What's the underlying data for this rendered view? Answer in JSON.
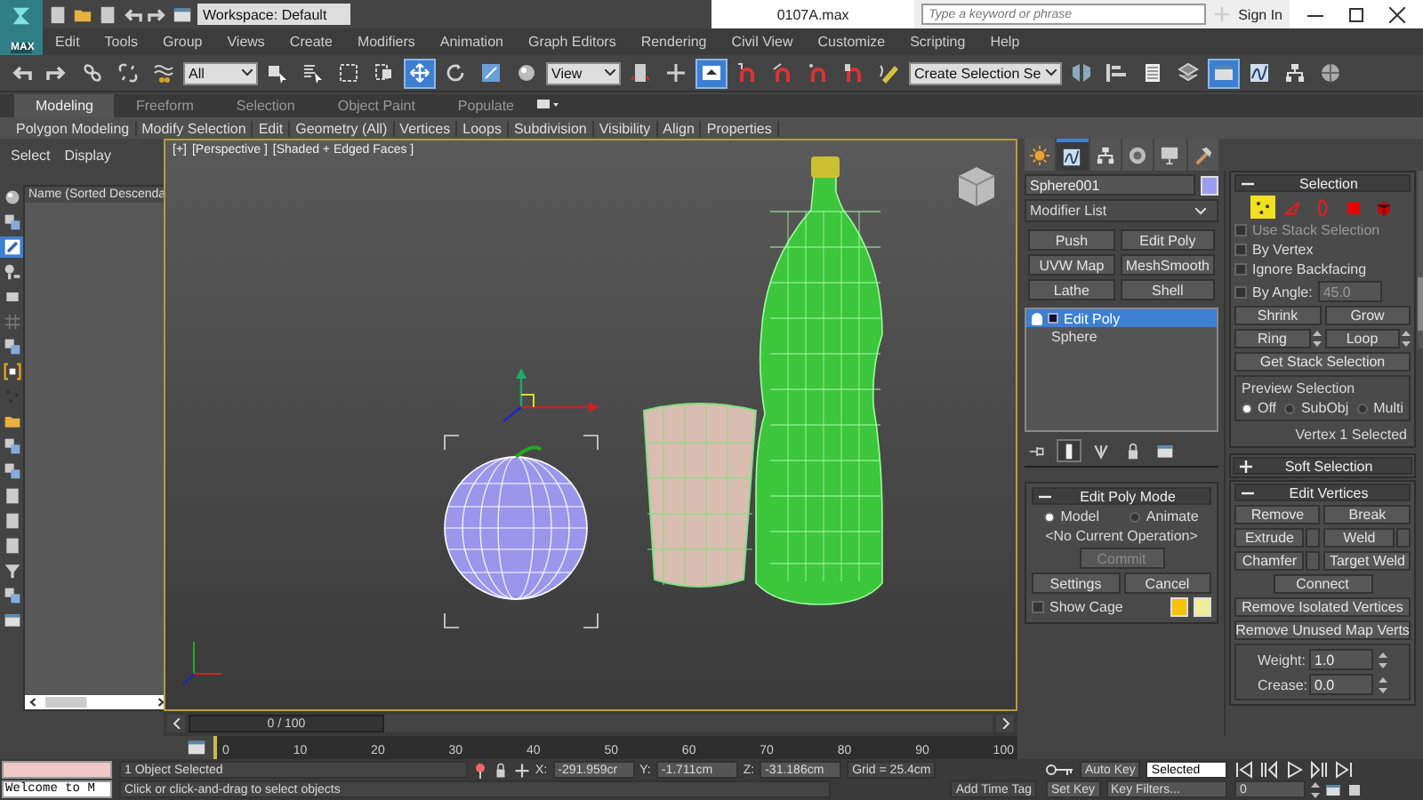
{
  "logo": {
    "label": "MAX"
  },
  "title_bar": {
    "workspace": "Workspace: Default",
    "title": "0107A.max",
    "search": {
      "placeholder": "Type a keyword or phrase"
    },
    "sign_in": "Sign In"
  },
  "menu": [
    "Edit",
    "Tools",
    "Group",
    "Views",
    "Create",
    "Modifiers",
    "Animation",
    "Graph Editors",
    "Rendering",
    "Civil View",
    "Customize",
    "Scripting",
    "Help"
  ],
  "toolbar": [
    {
      "kind": "undo",
      "selected": false
    },
    {
      "kind": "redo",
      "selected": false
    },
    {
      "kind": "chain",
      "selected": false
    },
    {
      "kind": "broken-chain",
      "selected": false
    },
    {
      "kind": "wave",
      "selected": false
    },
    {
      "kind": "dropdown",
      "value": "All",
      "selected": false
    },
    {
      "kind": "cube-cursor",
      "selected": false
    },
    {
      "kind": "list-cursor",
      "selected": false
    },
    {
      "kind": "dashed-square",
      "selected": false
    },
    {
      "kind": "window-crossing",
      "selected": false
    },
    {
      "kind": "move",
      "selected": true
    },
    {
      "kind": "rotate",
      "selected": false
    },
    {
      "kind": "scale",
      "selected": false
    },
    {
      "kind": "sphere",
      "selected": false
    },
    {
      "kind": "dropdown",
      "value": "View",
      "selected": false
    },
    {
      "kind": "pivot",
      "selected": false
    },
    {
      "kind": "crosshair",
      "selected": false
    },
    {
      "kind": "box-arrow",
      "selected": true
    },
    {
      "kind": "magnet",
      "selected": false
    },
    {
      "kind": "angle-magnet",
      "selected": false
    },
    {
      "kind": "percent-magnet",
      "selected": false
    },
    {
      "kind": "spinner-magnet",
      "selected": false
    },
    {
      "kind": "pencil",
      "selected": false
    },
    {
      "kind": "dropdown",
      "value": "Create Selection Se",
      "selected": false
    },
    {
      "kind": "mirror",
      "selected": false
    },
    {
      "kind": "align",
      "selected": false
    },
    {
      "kind": "list",
      "selected": false
    },
    {
      "kind": "layers",
      "selected": false
    },
    {
      "kind": "window-panel",
      "selected": true
    },
    {
      "kind": "curve",
      "selected": false
    },
    {
      "kind": "schematic",
      "selected": false
    },
    {
      "kind": "sphere-grid",
      "selected": false
    }
  ],
  "ribbon": {
    "tabs": [
      {
        "label": "Modeling",
        "selected": true
      },
      {
        "label": "Freeform",
        "selected": false
      },
      {
        "label": "Selection",
        "selected": false
      },
      {
        "label": "Object Paint",
        "selected": false
      },
      {
        "label": "Populate",
        "selected": false
      }
    ],
    "panels": [
      "Polygon Modeling",
      "Modify Selection",
      "Edit",
      "Geometry (All)",
      "Vertices",
      "Loops",
      "Subdivision",
      "Visibility",
      "Align",
      "Properties"
    ]
  },
  "scene_explorer": {
    "tabs": [
      "Select",
      "Display"
    ],
    "column": "Name (Sorted Descenda",
    "tools": [
      {
        "kind": "sphere",
        "selected": false
      },
      {
        "kind": "boxes",
        "selected": false
      },
      {
        "kind": "brush",
        "selected": true
      },
      {
        "kind": "bone",
        "selected": false
      },
      {
        "kind": "camera",
        "selected": false
      },
      {
        "kind": "grid",
        "selected": false
      },
      {
        "kind": "boxes",
        "selected": false
      },
      {
        "kind": "bracket",
        "selected": false
      },
      {
        "kind": "dots",
        "selected": false
      },
      {
        "kind": "folder",
        "selected": false
      },
      {
        "kind": "boxes",
        "selected": false
      },
      {
        "kind": "boxes",
        "selected": false
      },
      {
        "kind": "page",
        "selected": false
      },
      {
        "kind": "page",
        "selected": false
      },
      {
        "kind": "page",
        "selected": false
      },
      {
        "kind": "funnel",
        "selected": false
      },
      {
        "kind": "boxes",
        "selected": false
      },
      {
        "kind": "window-panel",
        "selected": false
      }
    ]
  },
  "viewport": {
    "labels": [
      "[+]",
      "[Perspective ]",
      "[Shaded + Edged Faces ]"
    ]
  },
  "command_panel": {
    "tabs": [
      {
        "kind": "sun",
        "selected": false
      },
      {
        "kind": "curve",
        "selected": true
      },
      {
        "kind": "schematic",
        "selected": false
      },
      {
        "kind": "motion",
        "selected": false
      },
      {
        "kind": "monitor",
        "selected": false
      },
      {
        "kind": "hammer",
        "selected": false
      }
    ],
    "object_name": "Sphere001",
    "modifier_list": "Modifier List",
    "modifier_buttons": [
      "Push",
      "Edit Poly",
      "UVW Map",
      "MeshSmooth",
      "Lathe",
      "Shell"
    ],
    "stack": [
      {
        "label": "Edit Poly",
        "selected": true,
        "kind": "modifier"
      },
      {
        "label": "Sphere",
        "selected": false,
        "kind": "base"
      }
    ],
    "stack_tools": [
      {
        "kind": "pin",
        "selected": false
      },
      {
        "kind": "bar",
        "selected": true
      },
      {
        "kind": "fork",
        "selected": false
      },
      {
        "kind": "padlock",
        "selected": false
      },
      {
        "kind": "window-panel",
        "selected": false
      }
    ],
    "edit_poly_mode": {
      "title": "Edit Poly Mode",
      "expanded": true,
      "modes": [
        {
          "label": "Model",
          "selected": true
        },
        {
          "label": "Animate",
          "selected": false
        }
      ],
      "operation": "<No Current Operation>",
      "buttons": [
        {
          "label": "Commit",
          "disabled": true
        },
        {
          "label": "Settings",
          "disabled": false
        },
        {
          "label": "Cancel",
          "disabled": false
        }
      ],
      "show_cage": {
        "label": "Show Cage",
        "checked": false
      }
    },
    "selection": {
      "title": "Selection",
      "expanded": true,
      "levels": [
        {
          "kind": "dots",
          "selected": true
        },
        {
          "kind": "edge",
          "selected": false
        },
        {
          "kind": "border",
          "selected": false
        },
        {
          "kind": "square",
          "selected": false
        },
        {
          "kind": "cube",
          "selected": false
        }
      ],
      "options": [
        {
          "label": "Use Stack Selection",
          "checked": false,
          "disabled": true
        },
        {
          "label": "By Vertex",
          "checked": false,
          "disabled": false
        },
        {
          "label": "Ignore Backfacing",
          "checked": false,
          "disabled": false
        },
        {
          "label": "By Angle:",
          "checked": false,
          "disabled": false
        }
      ],
      "angle": "45.0",
      "shrink": "Shrink",
      "grow": "Grow",
      "ring": "Ring",
      "loop": "Loop",
      "get_stack": "Get Stack Selection",
      "preview": {
        "title": "Preview Selection",
        "options": [
          {
            "label": "Off",
            "selected": true
          },
          {
            "label": "SubObj",
            "selected": false
          },
          {
            "label": "Multi",
            "selected": false
          }
        ]
      },
      "status": "Vertex 1 Selected"
    },
    "soft_selection": {
      "title": "Soft Selection",
      "expanded": false
    },
    "edit_vertices": {
      "title": "Edit Vertices",
      "expanded": true,
      "buttons": [
        {
          "label": "Remove",
          "settings": false
        },
        {
          "label": "Break",
          "settings": false
        },
        {
          "label": "Extrude",
          "settings": true
        },
        {
          "label": "Weld",
          "settings": true
        },
        {
          "label": "Chamfer",
          "settings": true
        },
        {
          "label": "Target Weld",
          "settings": false
        }
      ],
      "wide_buttons": [
        "Connect",
        "Remove Isolated Vertices",
        "Remove Unused Map Verts"
      ],
      "fields": [
        {
          "label": "Weight:",
          "value": "1.0"
        },
        {
          "label": "Crease:",
          "value": "0.0"
        }
      ]
    }
  },
  "time_slider": {
    "label": "0 / 100",
    "level": 0
  },
  "track_ticks": [
    "0",
    "10",
    "20",
    "30",
    "40",
    "50",
    "60",
    "70",
    "80",
    "90",
    "100"
  ],
  "listener": {
    "output": "Welcome to M"
  },
  "status_bar": {
    "selection": "1 Object Selected",
    "prompt": "Click or click-and-drag to select objects",
    "coords": [
      {
        "label": "X:",
        "value": "-291.959cr"
      },
      {
        "label": "Y:",
        "value": "-1.711cm"
      },
      {
        "label": "Z:",
        "value": "-31.186cm"
      }
    ],
    "grid": "Grid = 25.4cm",
    "time_tag": "Add Time Tag"
  },
  "animation": {
    "auto_key": "Auto Key",
    "set_key": "Set Key",
    "key_set": "Selected",
    "key_filters": "Key Filters...",
    "frame": "0"
  }
}
